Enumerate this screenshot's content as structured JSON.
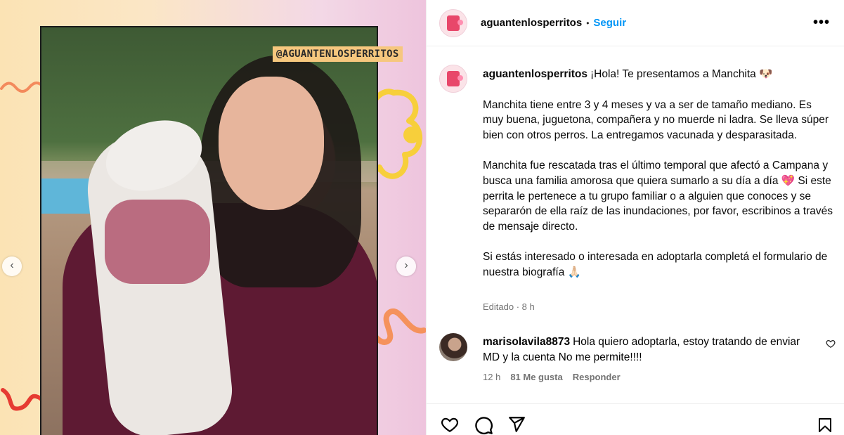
{
  "media": {
    "watermark": "@AGUANTENLOSPERRITOS",
    "prev_arrow": "‹",
    "next_arrow": "›"
  },
  "header": {
    "username": "aguantenlosperritos",
    "separator": "•",
    "follow_label": "Seguir",
    "more_label": "•••"
  },
  "caption": {
    "username": "aguantenlosperritos",
    "paragraphs": [
      "¡Hola! Te presentamos a Manchita 🐶",
      "Manchita tiene entre 3 y 4 meses y va a ser de tamaño mediano. Es muy buena, juguetona, compañera y no muerde ni ladra. Se lleva súper bien con otros perros. La entregamos vacunada y desparasitada.",
      "Manchita fue rescatada tras el último temporal que afectó a Campana y busca una familia amorosa que quiera sumarlo a su día a día 💖 Si este perrita le pertenece a tu grupo familiar o a alguien que conoces y se separarón de ella raíz de las inundaciones, por favor, escribinos a través de mensaje directo.",
      "Si estás interesado o interesada en adoptarla completá el formulario de nuestra biografía 🙏🏻"
    ],
    "edited": "Editado",
    "time": "8 h"
  },
  "comment": {
    "username": "marisolavila8873",
    "text": "Hola quiero adoptarla, estoy tratando de enviar MD y la cuenta No me permite!!!!",
    "time": "12 h",
    "likes": "81 Me gusta",
    "reply_label": "Responder"
  },
  "icons": {
    "like": "heart-icon",
    "comment": "comment-icon",
    "share": "share-icon",
    "save": "bookmark-icon"
  },
  "colors": {
    "accent": "#0095f6",
    "muted": "#737373",
    "divider": "#efefef"
  }
}
